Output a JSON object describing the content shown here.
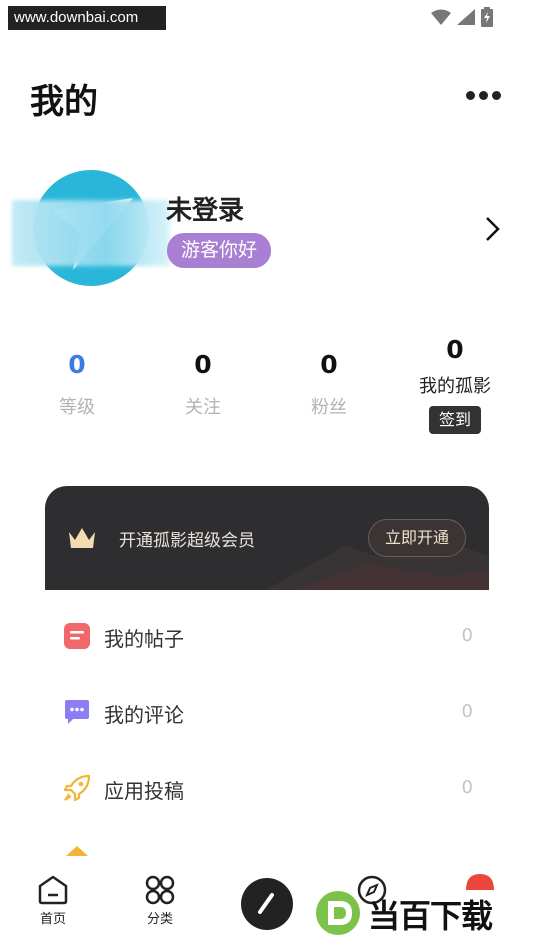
{
  "statusbar": {
    "watermark": "www.downbai.com"
  },
  "header": {
    "title": "我的"
  },
  "profile": {
    "username": "未登录",
    "tag": "游客你好"
  },
  "stats": [
    {
      "value": "0",
      "label": "等级"
    },
    {
      "value": "0",
      "label": "关注"
    },
    {
      "value": "0",
      "label": "粉丝"
    },
    {
      "value": "0",
      "label": "我的孤影",
      "action": "签到"
    }
  ],
  "vip": {
    "text": "开通孤影超级会员",
    "button": "立即开通"
  },
  "menu": [
    {
      "label": "我的帖子",
      "count": "0",
      "icon": "post-icon"
    },
    {
      "label": "我的评论",
      "count": "0",
      "icon": "comment-icon"
    },
    {
      "label": "应用投稿",
      "count": "0",
      "icon": "rocket-icon"
    }
  ],
  "nav": [
    {
      "label": "首页",
      "icon": "home-icon"
    },
    {
      "label": "分类",
      "icon": "category-icon"
    },
    {
      "label": "",
      "icon": "pencil-icon"
    },
    {
      "label": "",
      "icon": "compass-icon"
    },
    {
      "label": "",
      "icon": "profile-icon"
    }
  ],
  "watermark_logo": {
    "text": "当百下载"
  },
  "colors": {
    "accent_blue": "#3c7be0",
    "tag_purple": "#a87fd2",
    "vip_dark": "#2e2d30"
  }
}
